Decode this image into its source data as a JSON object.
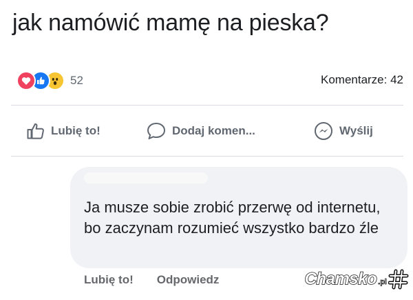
{
  "post": {
    "text": "jak namówić mamę na pieska?"
  },
  "reactions": {
    "count": "52",
    "types": [
      "love",
      "like",
      "wow"
    ]
  },
  "comments_count": "Komentarze: 42",
  "actions": {
    "like": "Lubię to!",
    "comment": "Dodaj komen...",
    "send": "Wyślij"
  },
  "comment": {
    "text": "Ja musze sobie zrobić przerwę od internetu, bo zaczynam rozumieć wszystko bardzo źle",
    "like": "Lubię to!",
    "reply": "Odpowiedz"
  },
  "watermark": {
    "text": "Chamsko",
    "suffix": ".pl"
  },
  "colors": {
    "love": "#f0415f",
    "like": "#1877f2",
    "wow": "#f7c531",
    "bubble": "#f0f2f5"
  }
}
